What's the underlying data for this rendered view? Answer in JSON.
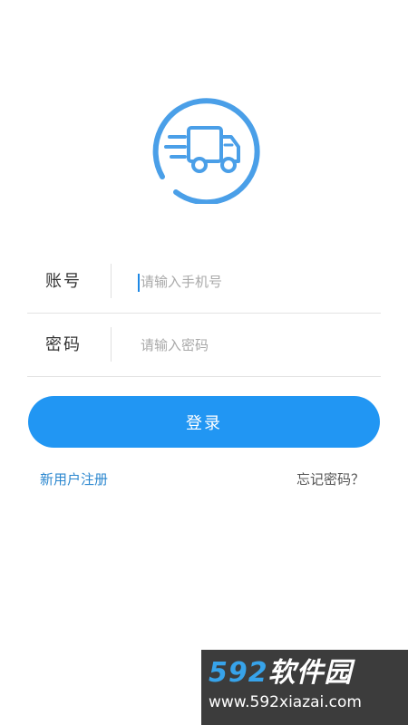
{
  "colors": {
    "accent": "#2196f3",
    "logo": "#4a9fe8",
    "link": "#2b87cf",
    "watermark_background": "#3c3c3c"
  },
  "logo": {
    "icon": "delivery-truck-icon"
  },
  "form": {
    "account": {
      "label": "账号",
      "value": "",
      "placeholder": "请输入手机号"
    },
    "password": {
      "label": "密码",
      "value": "",
      "placeholder": "请输入密码"
    }
  },
  "login_button": {
    "label": "登录"
  },
  "links": {
    "register": "新用户注册",
    "forgot_password": "忘记密码？"
  },
  "watermark": {
    "brand_number": "592",
    "brand_text": "软件园",
    "url": "www.592xiazai.com"
  }
}
